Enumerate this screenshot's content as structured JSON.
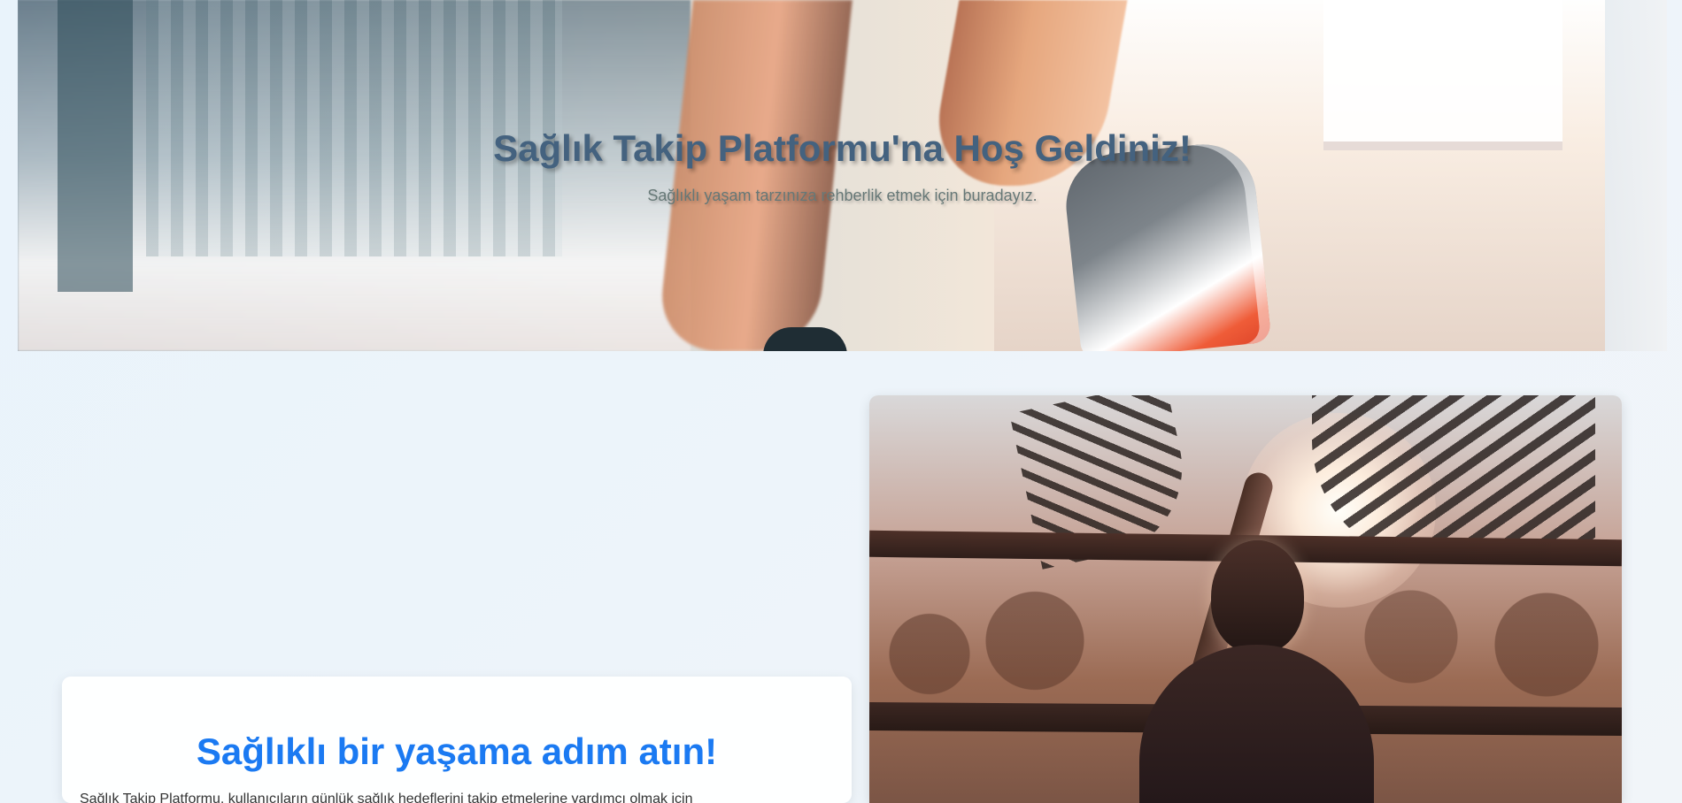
{
  "hero": {
    "title": "Sağlık Takip Platformu'na Hoş Geldiniz!",
    "subtitle": "Sağlıklı yaşam tarzınıza rehberlik etmek için buradayız."
  },
  "content": {
    "heading": "Sağlıklı bir yaşama adım atın!",
    "text": "Sağlık Takip Platformu, kullanıcıların günlük sağlık hedeflerini takip etmelerine yardımcı olmak için"
  },
  "colors": {
    "page_background": "#e9f3fb",
    "hero_title": "#44627f",
    "content_heading": "#1b7af2"
  }
}
